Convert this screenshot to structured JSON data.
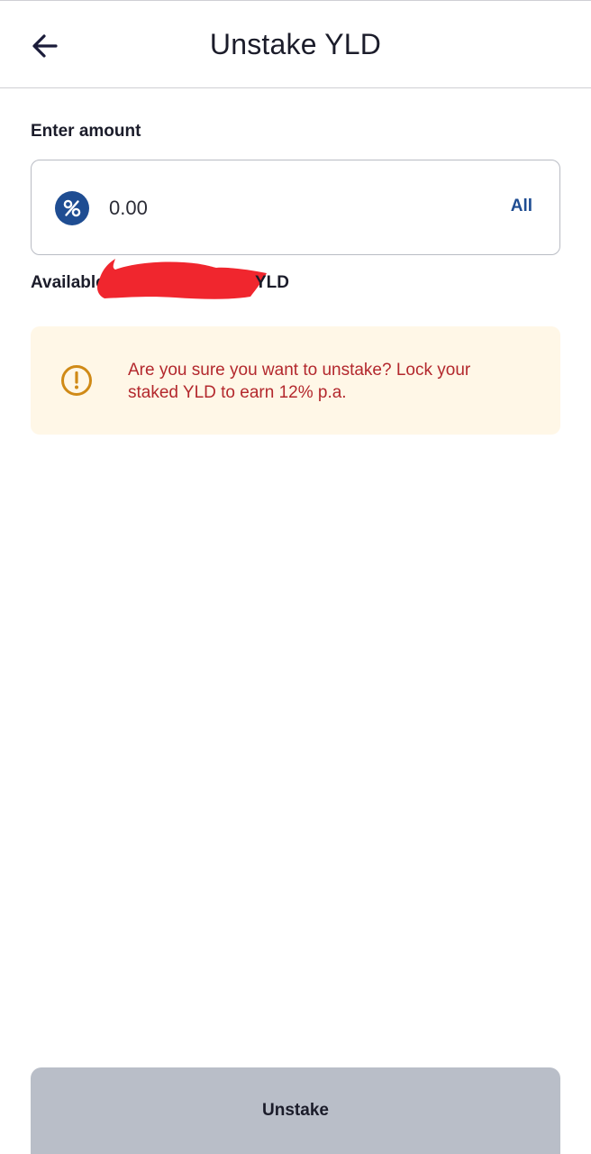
{
  "header": {
    "title": "Unstake YLD",
    "back_icon": "arrow-left-icon"
  },
  "amount": {
    "label": "Enter amount",
    "value": "0.00",
    "token_icon": "percent-token-icon",
    "all_label": "All"
  },
  "available": {
    "prefix": "Available",
    "unit": "YLD"
  },
  "warning": {
    "icon": "alert-circle-icon",
    "text": "Are you sure you want to unstake? Lock your staked YLD to earn 12% p.a."
  },
  "footer": {
    "unstake_label": "Unstake"
  },
  "colors": {
    "accent": "#1f4d92",
    "warning_bg": "#fff7e7",
    "warning_text": "#b3282d",
    "warning_icon": "#d08a17",
    "disabled_button": "#b9bec8",
    "redaction": "#f0262e"
  }
}
